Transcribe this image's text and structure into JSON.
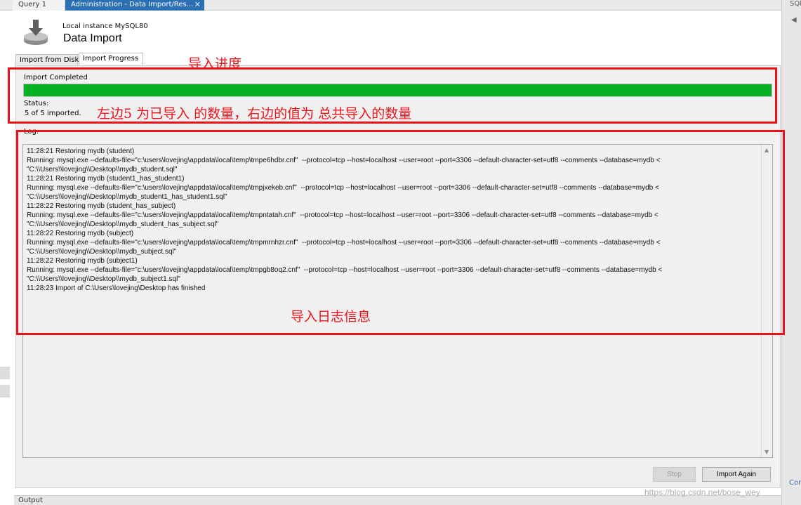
{
  "tabs": [
    {
      "label": "Query 1"
    },
    {
      "label": "Administration - Data Import/Res..."
    }
  ],
  "tab_close_glyph": "✕",
  "right_panel": {
    "label": "SQL",
    "arrow": "◀",
    "footer": "Cor"
  },
  "header": {
    "instance": "Local instance MySQL80",
    "title": "Data Import",
    "icon": "database-import-icon"
  },
  "inner_tabs": [
    {
      "label": "Import from Disk"
    },
    {
      "label": "Import Progress"
    }
  ],
  "progress": {
    "title": "Import Completed",
    "fraction": 1.0,
    "status_label": "Status:",
    "status_value": "5 of 5 imported.",
    "fill_color": "#06b025"
  },
  "log": {
    "label": "Log:",
    "lines": [
      "11:28:21 Restoring mydb (student)",
      "Running: mysql.exe --defaults-file=\"c:\\users\\lovejing\\appdata\\local\\temp\\tmpe6hdbr.cnf\"  --protocol=tcp --host=localhost --user=root --port=3306 --default-character-set=utf8 --comments --database=mydb < \"C:\\\\Users\\\\lovejing\\\\Desktop\\\\mydb_student.sql\"",
      "11:28:21 Restoring mydb (student1_has_student1)",
      "Running: mysql.exe --defaults-file=\"c:\\users\\lovejing\\appdata\\local\\temp\\tmpjxekeb.cnf\"  --protocol=tcp --host=localhost --user=root --port=3306 --default-character-set=utf8 --comments --database=mydb < \"C:\\\\Users\\\\lovejing\\\\Desktop\\\\mydb_student1_has_student1.sql\"",
      "11:28:22 Restoring mydb (student_has_subject)",
      "Running: mysql.exe --defaults-file=\"c:\\users\\lovejing\\appdata\\local\\temp\\tmpntatah.cnf\"  --protocol=tcp --host=localhost --user=root --port=3306 --default-character-set=utf8 --comments --database=mydb < \"C:\\\\Users\\\\lovejing\\\\Desktop\\\\mydb_student_has_subject.sql\"",
      "11:28:22 Restoring mydb (subject)",
      "Running: mysql.exe --defaults-file=\"c:\\users\\lovejing\\appdata\\local\\temp\\tmpmrnhzr.cnf\"  --protocol=tcp --host=localhost --user=root --port=3306 --default-character-set=utf8 --comments --database=mydb < \"C:\\\\Users\\\\lovejing\\\\Desktop\\\\mydb_subject.sql\"",
      "11:28:22 Restoring mydb (subject1)",
      "Running: mysql.exe --defaults-file=\"c:\\users\\lovejing\\appdata\\local\\temp\\tmpgb8oq2.cnf\"  --protocol=tcp --host=localhost --user=root --port=3306 --default-character-set=utf8 --comments --database=mydb < \"C:\\\\Users\\\\lovejing\\\\Desktop\\\\mydb_subject1.sql\"",
      "11:28:23 Import of C:\\Users\\lovejing\\Desktop has finished"
    ]
  },
  "scroll": {
    "up": "▲",
    "down": "▼"
  },
  "buttons": {
    "stop": "Stop",
    "import_again": "Import Again"
  },
  "output_bar": {
    "label": "Output"
  },
  "annotations": {
    "progress": "导入进度",
    "count_note": "左边5 为已导入 的数量，右边的值为 总共导入的数量",
    "log": "导入日志信息",
    "color": "#e8141c"
  },
  "watermark": "https://blog.csdn.net/bose_wey"
}
